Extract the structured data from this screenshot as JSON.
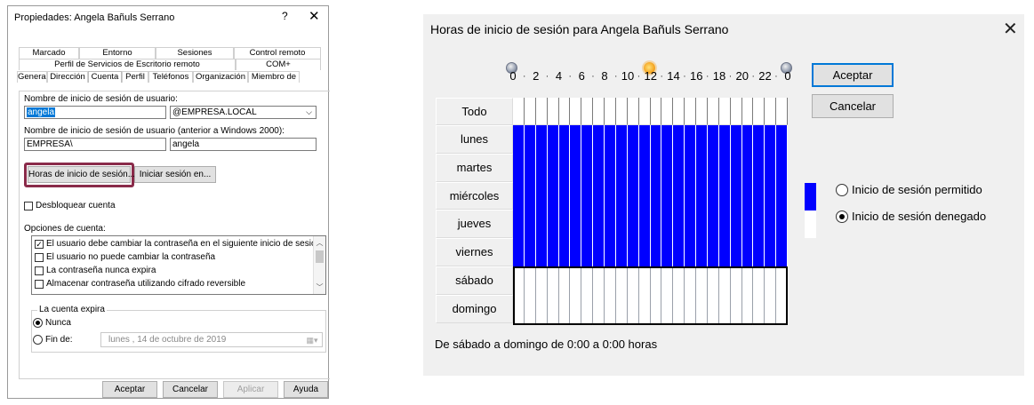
{
  "props_dialog": {
    "title": "Propiedades: Angela Bañuls Serrano",
    "help_glyph": "?",
    "close_glyph": "✕",
    "tabs_row1": [
      "Marcado",
      "Entorno",
      "Sesiones",
      "Control remoto"
    ],
    "tabs_row2": [
      "Perfil de Servicios de Escritorio remoto",
      "COM+"
    ],
    "tabs_row3": [
      "General",
      "Dirección",
      "Cuenta",
      "Perfil",
      "Teléfonos",
      "Organización",
      "Miembro de"
    ],
    "active_tab": "Cuenta",
    "logon_name_label": "Nombre de inicio de sesión de usuario:",
    "logon_name_value": "angela",
    "domain_suffix": "@EMPRESA.LOCAL",
    "pre2000_label": "Nombre de inicio de sesión de usuario (anterior a Windows 2000):",
    "pre2000_domain": "EMPRESA\\",
    "pre2000_user": "angela",
    "logon_hours_button": "Horas de inicio de sesión...",
    "logon_to_button": "Iniciar sesión en...",
    "unlock_label": "Desbloquear cuenta",
    "account_options_label": "Opciones de cuenta:",
    "account_options": [
      {
        "label": "El usuario debe cambiar la contraseña en el siguiente inicio de sesión",
        "checked": true
      },
      {
        "label": "El usuario no puede cambiar la contraseña",
        "checked": false
      },
      {
        "label": "La contraseña nunca expira",
        "checked": false
      },
      {
        "label": "Almacenar contraseña utilizando cifrado reversible",
        "checked": false
      }
    ],
    "expires_group_label": "La cuenta expira",
    "expires_never": "Nunca",
    "expires_end": "Fin de:",
    "expires_date": "lunes   , 14 de   octubre   de 2019",
    "buttons": {
      "ok": "Aceptar",
      "cancel": "Cancelar",
      "apply": "Aplicar",
      "help": "Ayuda"
    }
  },
  "hours_dialog": {
    "title": "Horas de inicio de sesión para Angela Bañuls Serrano",
    "close_glyph": "✕",
    "hour_labels": [
      "0",
      "2",
      "4",
      "6",
      "8",
      "10",
      "12",
      "14",
      "16",
      "18",
      "20",
      "22",
      "0"
    ],
    "all_label": "Todo",
    "days": [
      "lunes",
      "martes",
      "miércoles",
      "jueves",
      "viernes",
      "sábado",
      "domingo"
    ],
    "permitted_days": [
      true,
      true,
      true,
      true,
      true,
      false,
      false
    ],
    "ok_button": "Aceptar",
    "cancel_button": "Cancelar",
    "permitted_label": "Inicio de sesión permitido",
    "denied_label": "Inicio de sesión denegado",
    "selected_option": "denied",
    "status_text": "De sábado a domingo de 0:00 a 0:00 horas",
    "colors": {
      "permitted": "#0000ff",
      "denied": "#ffffff",
      "focus": "#0078d7",
      "highlight": "#8a2b4a"
    }
  }
}
